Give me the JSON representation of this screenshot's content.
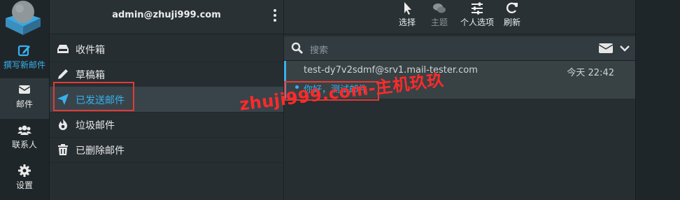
{
  "nav": {
    "compose_label": "撰写新邮件",
    "mail_label": "邮件",
    "contacts_label": "联系人",
    "settings_label": "设置"
  },
  "account": {
    "email": "admin@zhuji999.com"
  },
  "folders": [
    {
      "name": "收件箱",
      "icon": "inbox-icon"
    },
    {
      "name": "草稿箱",
      "icon": "pencil-icon"
    },
    {
      "name": "已发送邮件",
      "icon": "paper-plane-icon"
    },
    {
      "name": "垃圾邮件",
      "icon": "fire-icon"
    },
    {
      "name": "已删除邮件",
      "icon": "trash-icon"
    }
  ],
  "toolbar": {
    "select_label": "选择",
    "theme_label": "主题",
    "options_label": "个人选项",
    "refresh_label": "刷新"
  },
  "search": {
    "placeholder": "搜索"
  },
  "message": {
    "from": "test-dy7v2sdmf@srv1.mail-tester.com",
    "time": "今天 22:42",
    "subject": "你好，测试邮件"
  },
  "watermark": "zhuji999.com-主机玖玖",
  "colors": {
    "accent": "#39b0ee",
    "highlight_box": "#e53935"
  }
}
